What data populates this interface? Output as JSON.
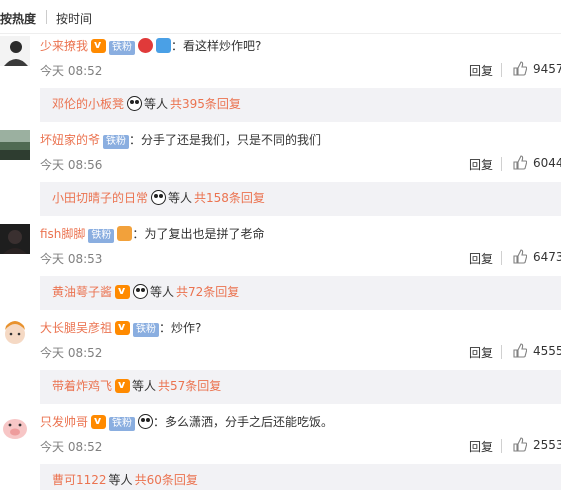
{
  "sort": {
    "hot": "按热度",
    "time": "按时间"
  },
  "comments": [
    {
      "user": "少来撩我",
      "has_v": true,
      "fan_badge": "铁粉",
      "extra_emojis": [
        "red",
        "blue"
      ],
      "colon": "：",
      "text": "看这样炒作吧?",
      "time": "今天 08:52",
      "reply_label": "回复",
      "likes": "9457",
      "reply_preview": {
        "name": "邓伦的小板凳",
        "emoji": "panda",
        "others": "等人",
        "count": "共395条回复"
      }
    },
    {
      "user": "坏妞家的爷",
      "has_v": false,
      "fan_badge": "铁粉",
      "extra_emojis": [],
      "colon": "：",
      "text": "分手了还是我们，只是不同的我们",
      "time": "今天 08:56",
      "reply_label": "回复",
      "likes": "6044",
      "reply_preview": {
        "name": "小田切晴子的日常",
        "emoji": "panda",
        "others": "等人",
        "count": "共158条回复"
      }
    },
    {
      "user": "fish脚脚",
      "has_v": false,
      "fan_badge": "铁粉",
      "extra_emojis": [
        "gift"
      ],
      "colon": "：",
      "text": "为了复出也是拼了老命",
      "time": "今天 08:53",
      "reply_label": "回复",
      "likes": "6473",
      "reply_preview": {
        "name": "黄油萼子酱",
        "emoji": "panda",
        "others": "等人",
        "count": "共72条回复"
      }
    },
    {
      "user": "大长腿吴彦祖",
      "has_v": true,
      "fan_badge": "铁粉",
      "extra_emojis": [],
      "colon": "：",
      "text": "炒作?",
      "time": "今天 08:52",
      "reply_label": "回复",
      "likes": "4555",
      "reply_preview": {
        "name": "带着炸鸡飞",
        "emoji": "vip",
        "others": "等人",
        "count": "共57条回复"
      }
    },
    {
      "user": "只发帅哥",
      "has_v": true,
      "fan_badge": "铁粉",
      "extra_emojis": [
        "panda"
      ],
      "colon": "：",
      "text": "多么潇洒，分手之后还能吃饭。",
      "time": "今天 08:52",
      "reply_label": "回复",
      "likes": "2553",
      "reply_preview": {
        "name": "曹可1122",
        "emoji": "",
        "others": "等人",
        "count": "共60条回复"
      }
    }
  ],
  "colors": {
    "username": "#eb7350",
    "fan_badge": "#8aaee0",
    "reply_bg": "#f2f2f5",
    "meta": "#808080"
  },
  "icons": {
    "like": "thumbs-up-icon",
    "vip": "v-badge-icon",
    "panda": "panda-emoji-icon"
  }
}
